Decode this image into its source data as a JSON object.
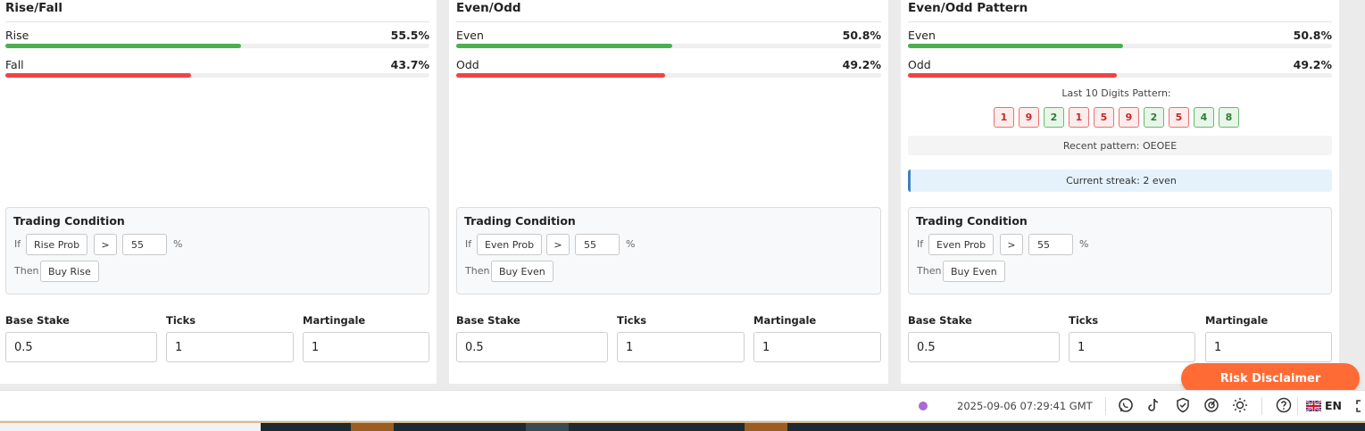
{
  "panels": [
    {
      "title": "Rise/Fall",
      "rows": [
        {
          "label": "Rise",
          "value": "55.5%",
          "percent": 55.5,
          "color": "#4caf50"
        },
        {
          "label": "Fall",
          "value": "43.7%",
          "percent": 43.7,
          "color": "#ef4444"
        }
      ],
      "condition": {
        "title": "Trading Condition",
        "if_label": "If",
        "select": "Rise Prob",
        "operator": ">",
        "threshold": "55",
        "unit": "%",
        "then_label": "Then",
        "action": "Buy Rise"
      },
      "fields": {
        "base_stake_label": "Base Stake",
        "base_stake": "0.5",
        "ticks_label": "Ticks",
        "ticks": "1",
        "martingale_label": "Martingale",
        "martingale": "1"
      }
    },
    {
      "title": "Even/Odd",
      "rows": [
        {
          "label": "Even",
          "value": "50.8%",
          "percent": 50.8,
          "color": "#4caf50"
        },
        {
          "label": "Odd",
          "value": "49.2%",
          "percent": 49.2,
          "color": "#ef4444"
        }
      ],
      "condition": {
        "title": "Trading Condition",
        "if_label": "If",
        "select": "Even Prob",
        "operator": ">",
        "threshold": "55",
        "unit": "%",
        "then_label": "Then",
        "action": "Buy Even"
      },
      "fields": {
        "base_stake_label": "Base Stake",
        "base_stake": "0.5",
        "ticks_label": "Ticks",
        "ticks": "1",
        "martingale_label": "Martingale",
        "martingale": "1"
      }
    },
    {
      "title": "Even/Odd Pattern",
      "rows": [
        {
          "label": "Even",
          "value": "50.8%",
          "percent": 50.8,
          "color": "#4caf50"
        },
        {
          "label": "Odd",
          "value": "49.2%",
          "percent": 49.2,
          "color": "#ef4444"
        }
      ],
      "digits_title": "Last 10 Digits Pattern:",
      "digits": [
        "1",
        "9",
        "2",
        "1",
        "5",
        "9",
        "2",
        "5",
        "4",
        "8"
      ],
      "recent_pattern": "Recent pattern: OEOEE",
      "streak": "Current streak: 2 even",
      "condition": {
        "title": "Trading Condition",
        "if_label": "If",
        "select": "Even Prob",
        "operator": ">",
        "threshold": "55",
        "unit": "%",
        "then_label": "Then",
        "action": "Buy Even"
      },
      "fields": {
        "base_stake_label": "Base Stake",
        "base_stake": "0.5",
        "ticks_label": "Ticks",
        "ticks": "1",
        "martingale_label": "Martingale",
        "martingale": "1"
      }
    }
  ],
  "risk_disclaimer": "Risk Disclaimer",
  "footer": {
    "status_color": "#a66bd4",
    "timestamp": "2025-09-06 07:29:41 GMT",
    "icons": [
      "whatsapp-icon",
      "tiktok-icon",
      "shield-icon",
      "gauge-icon",
      "sun-icon",
      "help-icon"
    ],
    "language": "EN"
  },
  "colors": {
    "accent_orange": "#ff6b35",
    "green": "#4caf50",
    "red": "#ef4444"
  }
}
